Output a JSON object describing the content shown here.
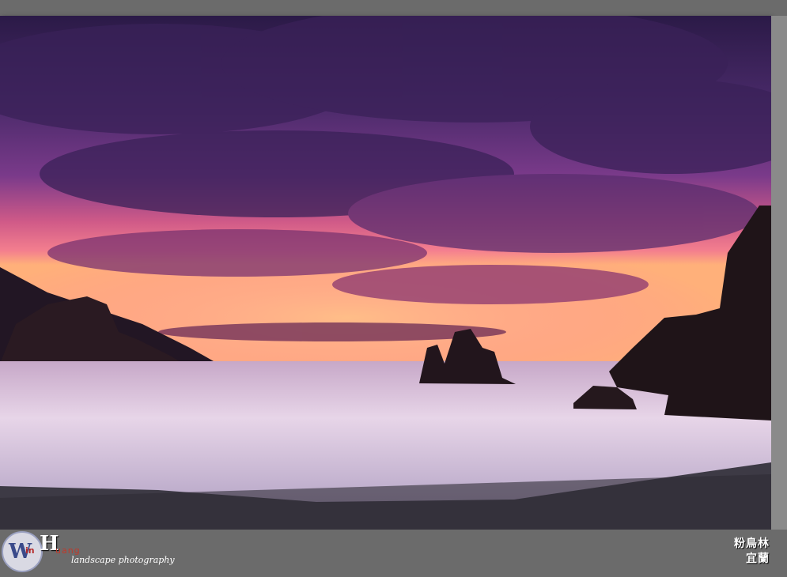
{
  "photo": {
    "colors": {
      "sky_top": "#2b1a47",
      "sky_mid": "#7a3a8a",
      "sky_glow": "#f07090",
      "horizon": "#ffb07a",
      "water": "#d8c7e0",
      "beach": "#3d3a45",
      "rock": "#2a1a22"
    }
  },
  "watermark": {
    "logo_w": "W",
    "logo_in": "in",
    "logo_h": "H",
    "logo_rest": "uang",
    "subtitle": "landscape photography"
  },
  "location": {
    "line1": "粉鳥林",
    "line2": "宜蘭"
  }
}
